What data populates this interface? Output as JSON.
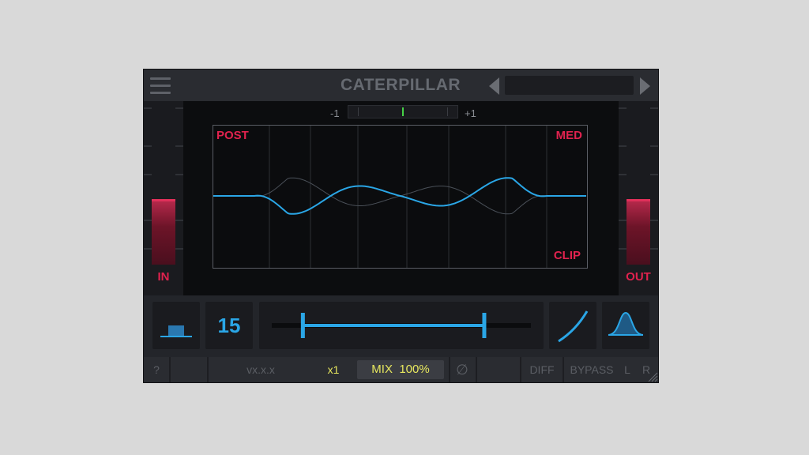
{
  "header": {
    "title": "CATERPILLAR",
    "preset_value": ""
  },
  "meter": {
    "min_label": "-1",
    "max_label": "+1",
    "correlation": 0
  },
  "faders": {
    "in_label": "IN",
    "out_label": "OUT",
    "in_level": 0.45,
    "out_level": 0.45
  },
  "graph": {
    "post_label": "POST",
    "med_label": "MED",
    "clip_label": "CLIP"
  },
  "controls": {
    "filter_icon": "lowpass-shape-icon",
    "value": "15",
    "range_low": 0.12,
    "range_high": 0.82,
    "curve_icon": "curve-icon",
    "bell_icon": "bell-icon"
  },
  "footer": {
    "help": "?",
    "version": "vx.x.x",
    "multiplier": "x1",
    "mix_label": "MIX",
    "mix_value": "100%",
    "phase_icon": "phase-invert-icon",
    "diff": "DIFF",
    "bypass": "BYPASS",
    "left": "L",
    "right": "R"
  },
  "colors": {
    "accent_blue": "#2aa6e6",
    "accent_red": "#e0224e",
    "accent_yellow": "#e7e75e",
    "meter_green": "#46d246"
  }
}
